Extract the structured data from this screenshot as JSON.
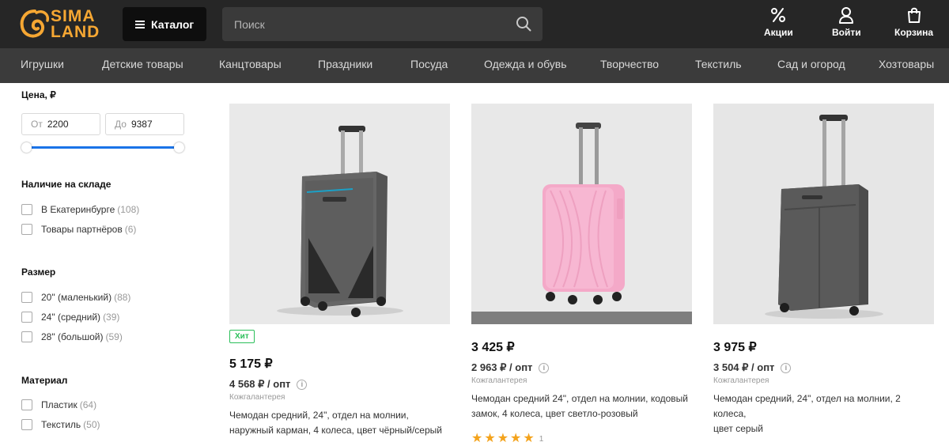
{
  "header": {
    "logo_text_1": "SIMA",
    "logo_text_2": "LAND",
    "catalog_label": "Каталог",
    "search_placeholder": "Поиск",
    "actions": [
      {
        "label": "Акции",
        "icon": "percent-icon"
      },
      {
        "label": "Войти",
        "icon": "user-icon"
      },
      {
        "label": "Корзина",
        "icon": "shopping-bag-icon"
      }
    ]
  },
  "nav": {
    "items": [
      "Игрушки",
      "Детские товары",
      "Канцтовары",
      "Праздники",
      "Посуда",
      "Одежда и обувь",
      "Творчество",
      "Текстиль",
      "Сад и огород",
      "Хозтовары"
    ]
  },
  "filters": {
    "price": {
      "title": "Цена, ₽",
      "from_label": "От",
      "from_value": "2200",
      "to_label": "До",
      "to_value": "9387"
    },
    "stock": {
      "title": "Наличие на складе",
      "options": [
        {
          "label": "В Екатеринбурге",
          "count": "(108)"
        },
        {
          "label": "Товары партнёров",
          "count": "(6)"
        }
      ]
    },
    "size": {
      "title": "Размер",
      "options": [
        {
          "label": "20\" (маленький)",
          "count": "(88)"
        },
        {
          "label": "24\" (средний)",
          "count": "(39)"
        },
        {
          "label": "28\" (большой)",
          "count": "(59)"
        }
      ]
    },
    "material": {
      "title": "Материал",
      "options": [
        {
          "label": "Пластик",
          "count": "(64)"
        },
        {
          "label": "Текстиль",
          "count": "(50)"
        }
      ]
    }
  },
  "products": [
    {
      "badge": "Хит",
      "price": "5 175 ₽",
      "opt_price": "4 568 ₽ / опт",
      "brand": "Кожгалантерея",
      "desc_line1": "Чемодан средний, 24\", отдел на молнии,",
      "desc_line2": "наружный карман, 4 колеса, цвет чёрный/серый",
      "color": "dark grey"
    },
    {
      "price": "3 425 ₽",
      "opt_price": "2 963 ₽ / опт",
      "brand": "Кожгалантерея",
      "desc_line1": "Чемодан средний 24\", отдел на молнии, кодовый",
      "desc_line2": "замок, 4 колеса, цвет светло-розовый",
      "rating": 5,
      "rating_count": "1",
      "color": "light pink"
    },
    {
      "price": "3 975 ₽",
      "opt_price": "3 504 ₽ / опт",
      "brand": "Кожгалантерея",
      "desc_line1": "Чемодан средний, 24\", отдел на молнии, 2 колеса,",
      "desc_line2": "цвет серый",
      "color": "grey"
    }
  ],
  "colors": {
    "header_bg": "#262626",
    "nav_bg": "#3b3b3b",
    "logo": "#f6a733",
    "accent": "#1a73e8",
    "hit_badge": "#2bbf5a",
    "star": "#f4a31c"
  }
}
